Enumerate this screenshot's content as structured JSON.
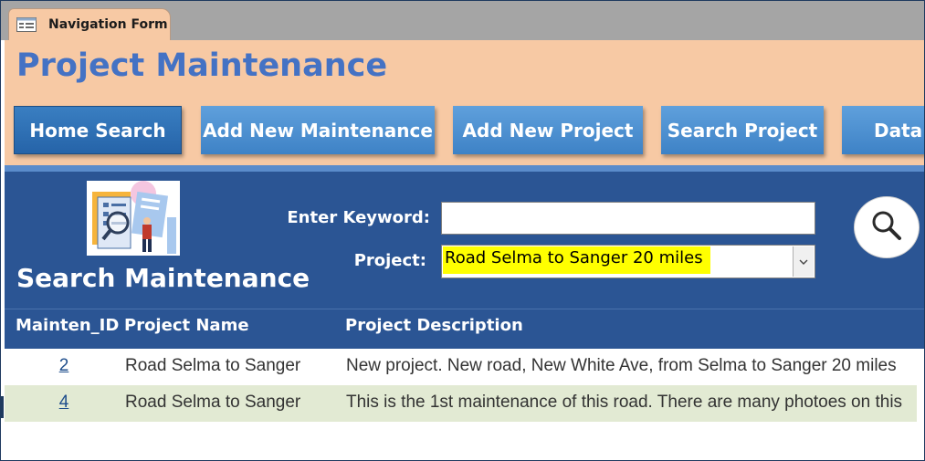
{
  "window": {
    "tab_label": "Navigation Form",
    "tab_icon": "form-icon"
  },
  "header": {
    "title": "Project Maintenance"
  },
  "nav": {
    "buttons": [
      {
        "label": "Home Search",
        "active": true
      },
      {
        "label": "Add New Maintenance",
        "active": false
      },
      {
        "label": "Add New Project",
        "active": false
      },
      {
        "label": "Search Project",
        "active": false
      },
      {
        "label": "Data Li",
        "active": false
      }
    ]
  },
  "search": {
    "title": "Search Maintenance",
    "image_icon": "search-document-illustration-icon",
    "keyword_label": "Enter Keyword:",
    "keyword_value": "",
    "project_label": "Project:",
    "project_value": "Road Selma to Sanger 20 miles",
    "search_icon": "magnifier-icon"
  },
  "grid": {
    "columns": [
      "Mainten_ID",
      "Project Name",
      "Project Description"
    ],
    "rows": [
      {
        "id": "2",
        "name": "Road Selma to Sanger",
        "description": "New project. New road, New White Ave, from Selma to Sanger 20 miles"
      },
      {
        "id": "4",
        "name": "Road Selma to Sanger",
        "description": "This is the 1st maintenance of this road. There are many photoes on this"
      }
    ]
  },
  "colors": {
    "header_bg": "#f7c9a4",
    "title_blue": "#4472c4",
    "button_blue": "#4a8fd0",
    "panel_navy": "#2b5594",
    "highlight_yellow": "#ffff00",
    "alt_row_green": "#e2ead3"
  }
}
